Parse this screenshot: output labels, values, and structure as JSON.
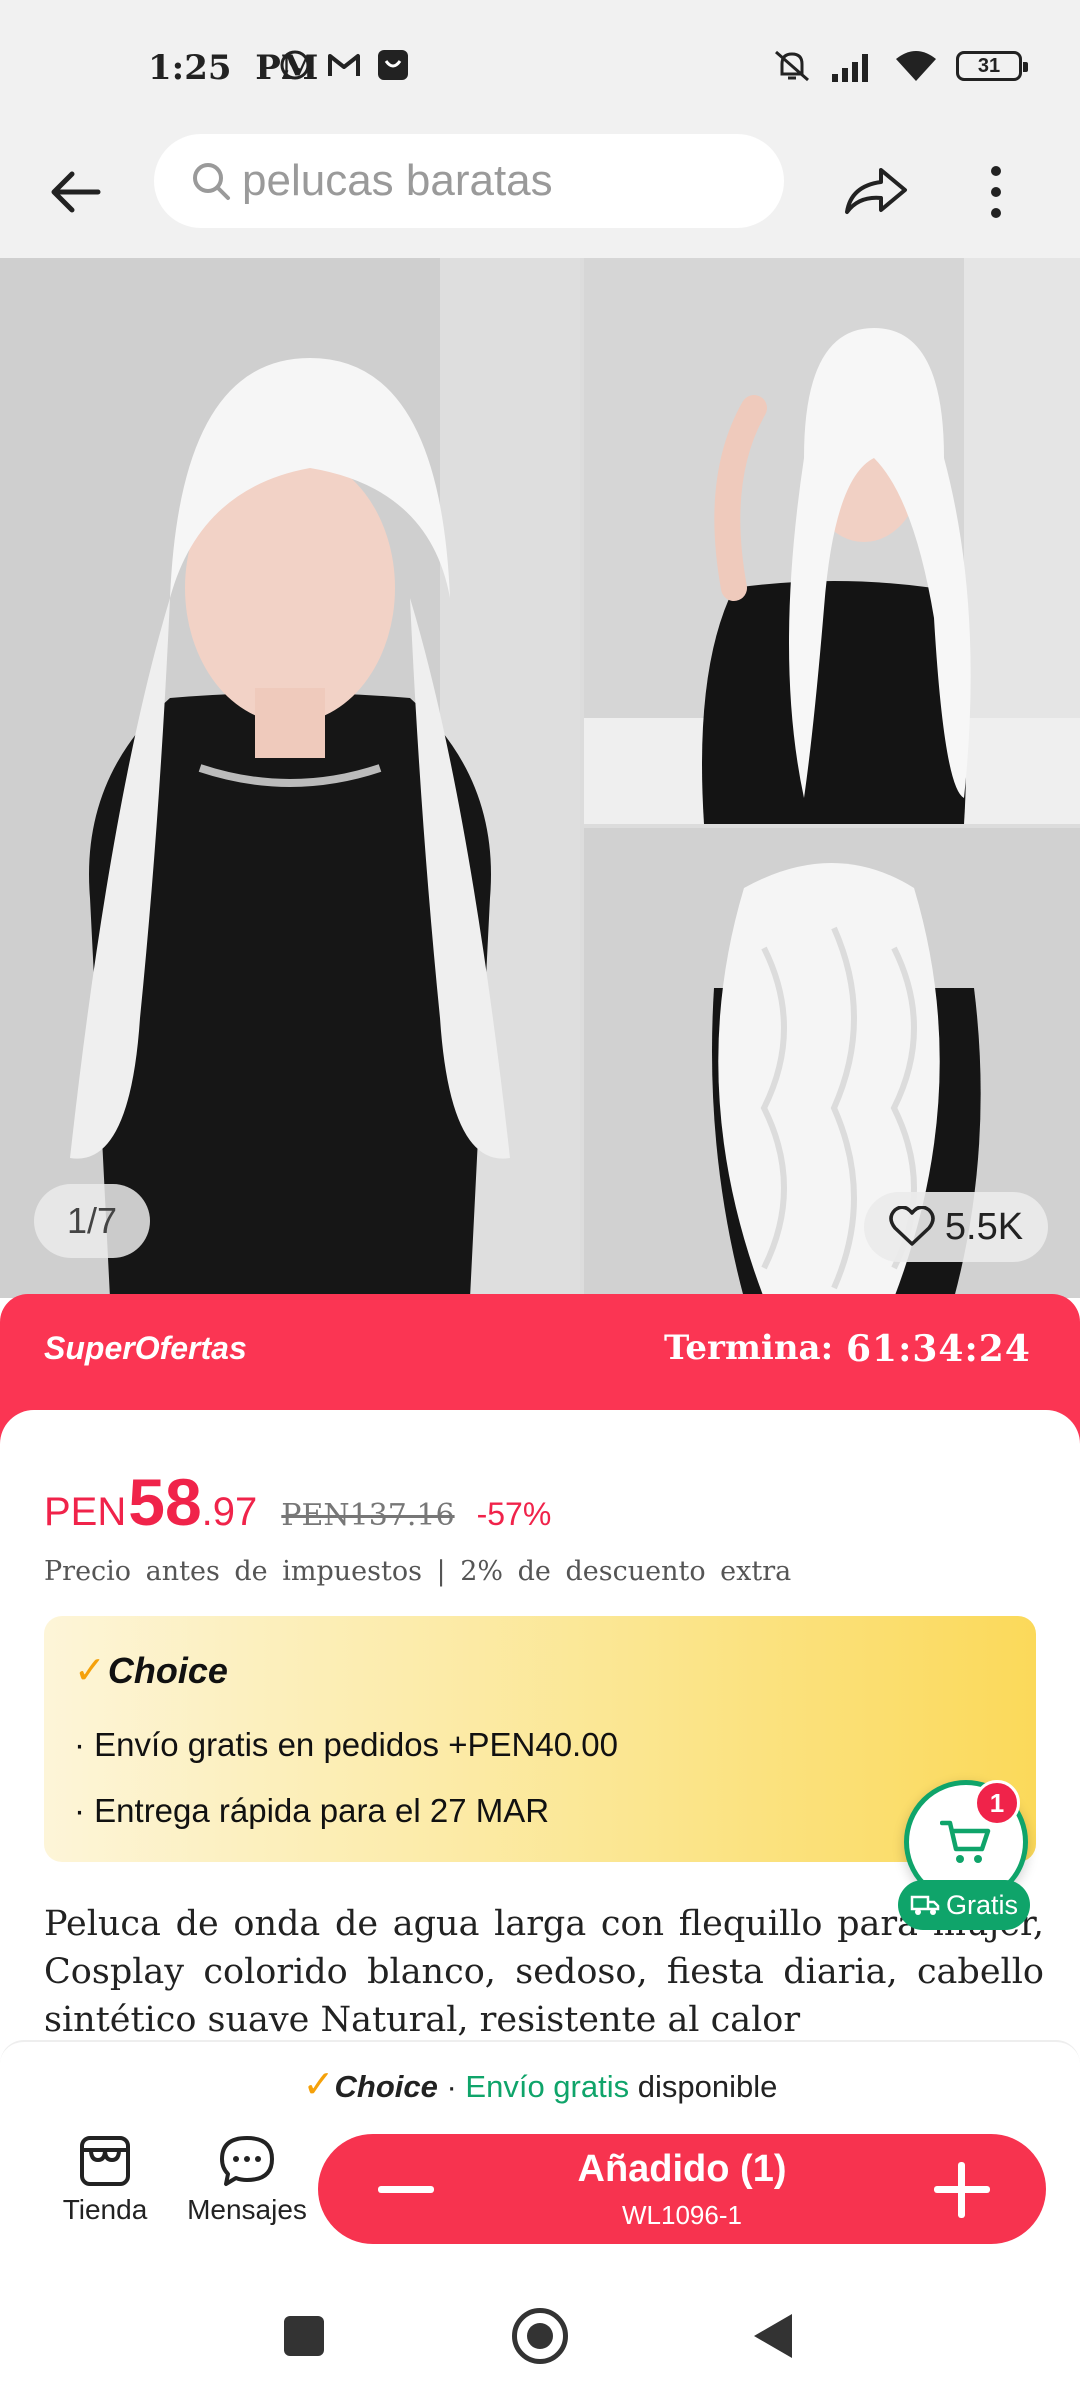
{
  "status_bar": {
    "time": "1:25",
    "ampm": "PM",
    "battery": "31",
    "left_icons": [
      "whatsapp-icon",
      "gmail-icon",
      "shopping-icon"
    ],
    "right_icons": [
      "mute-icon",
      "signal-icon",
      "wifi-icon",
      "battery-icon"
    ]
  },
  "header": {
    "search_value": "pelucas baratas"
  },
  "gallery": {
    "counter": "1/7",
    "likes": "5.5K"
  },
  "offer": {
    "title": "SuperOfertas",
    "ends_label": "Termina:",
    "timer": "61:34:24"
  },
  "price": {
    "currency": "PEN",
    "integer": "58",
    "decimal": ".97",
    "original": "PEN137.16",
    "discount": "-57%",
    "note": "Precio antes de impuestos | 2% de descuento extra"
  },
  "choice": {
    "label": "Choice",
    "line1": "· Envío gratis en pedidos +PEN40.00",
    "line2": "· Entrega rápida para el 27 MAR"
  },
  "product": {
    "title": "Peluca de onda de agua larga con flequillo para mujer, Cosplay colorido blanco, sedoso, fiesta diaria, cabello sintético suave Natural, resistente al calor"
  },
  "cart_fab": {
    "badge": "1",
    "gratis": "Gratis"
  },
  "bottom": {
    "choice_label": "Choice",
    "sep": " · ",
    "free_ship": "Envío gratis",
    "available": " disponible",
    "store_label": "Tienda",
    "messages_label": "Mensajes",
    "added_label": "Añadido (1)",
    "sku": "WL1096-1"
  },
  "colors": {
    "brand_red": "#f7334f",
    "offer_red": "#fb3553",
    "green": "#0fa46a",
    "choice_gold": "#fbd95a"
  }
}
